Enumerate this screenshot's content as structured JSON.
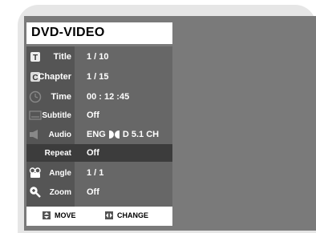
{
  "header": {
    "title": "DVD-VIDEO"
  },
  "menu": [
    {
      "label": "Title",
      "value": "1 / 10",
      "icon": "title-icon"
    },
    {
      "label": "Chapter",
      "value": "1 / 15",
      "icon": "chapter-icon"
    },
    {
      "label": "Time",
      "value": "00 : 12 :45",
      "icon": "clock-icon"
    },
    {
      "label": "Subtitle",
      "value": "Off",
      "icon": "subtitle-icon"
    },
    {
      "label": "Audio",
      "value_lang": "ENG",
      "value_fmt": "D 5.1 CH",
      "icon": "speaker-icon"
    },
    {
      "label": "Repeat",
      "value": "Off",
      "selected": true
    },
    {
      "label": "Angle",
      "value": "1 / 1",
      "icon": "camera-icon"
    },
    {
      "label": "Zoom",
      "value": "Off",
      "icon": "zoom-icon"
    }
  ],
  "footer": {
    "move": "MOVE",
    "change": "CHANGE"
  },
  "colors": {
    "frame": "#e6e6e6",
    "screen": "#7a7a7a",
    "label_column": "#555555",
    "value_column": "#676767",
    "selected_row": "#3c3c3c"
  }
}
